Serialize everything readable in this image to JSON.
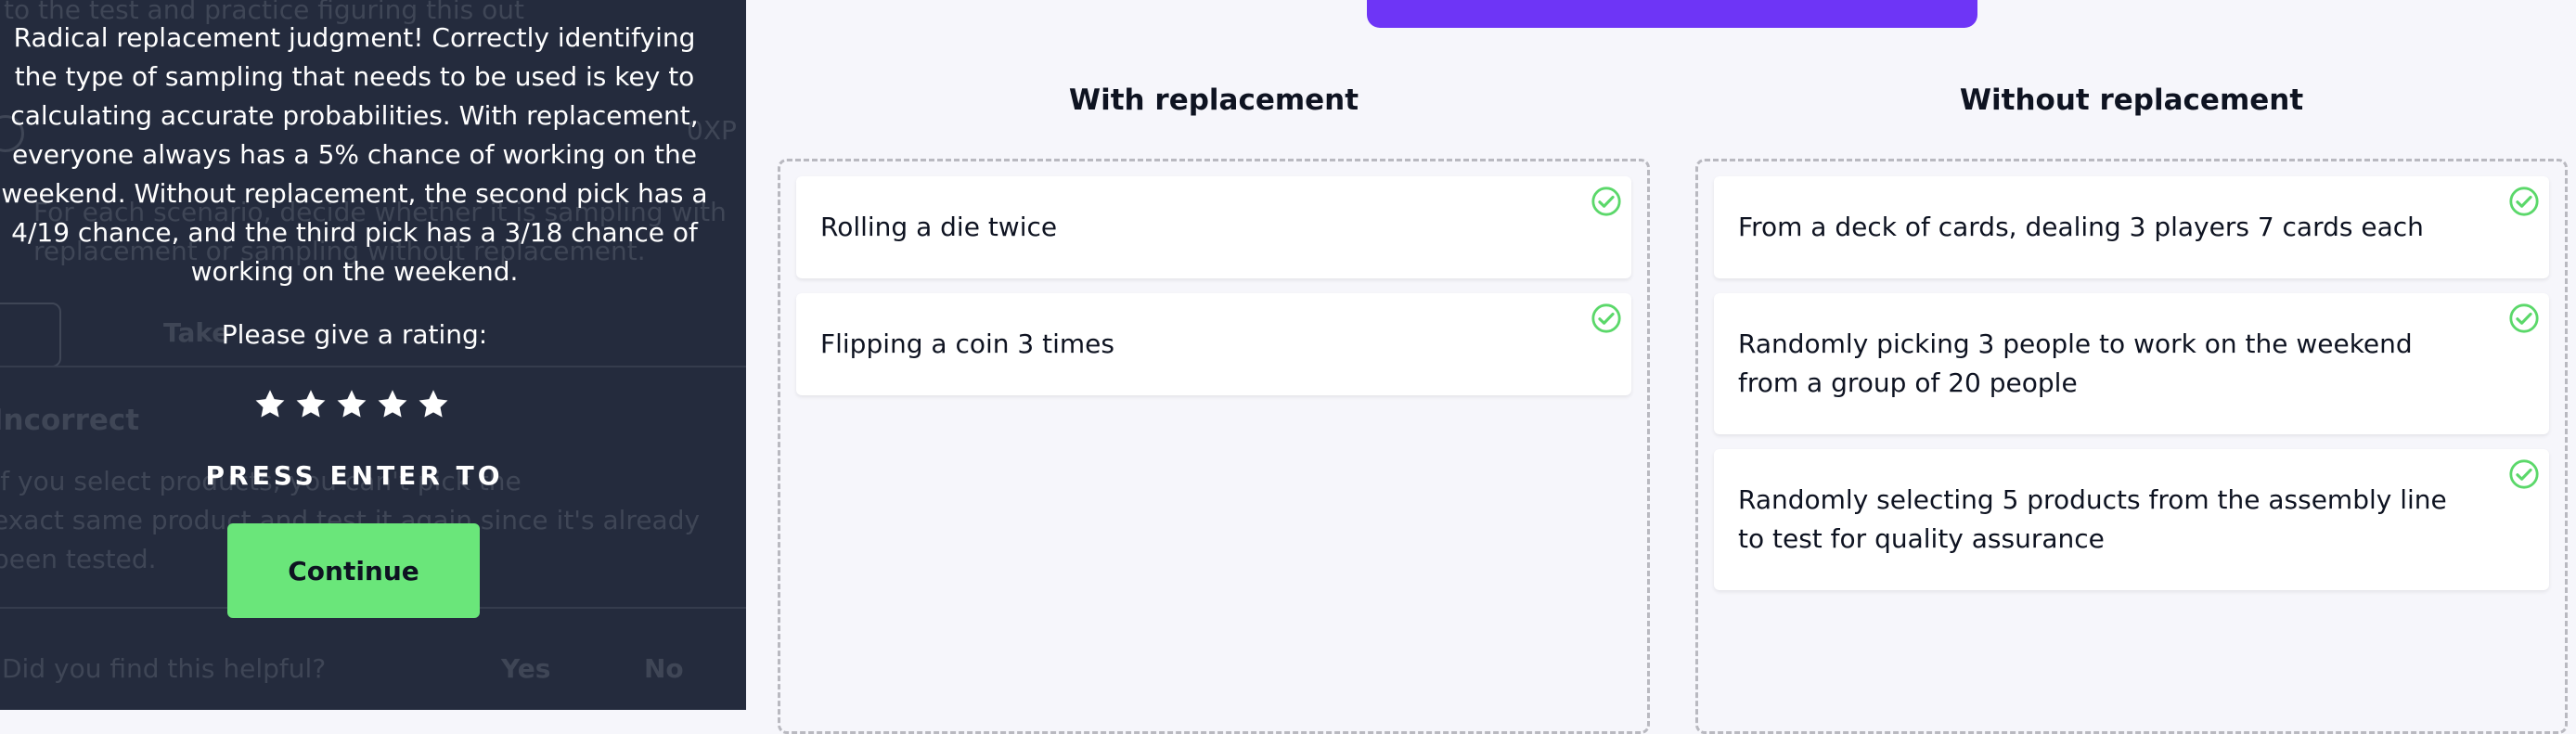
{
  "background_panel": {
    "lines": [
      "to the test and practice figuring this out",
      "0XP",
      "For each scenario, decide whether it is sampling with",
      "replacement or sampling without replacement.",
      "Take",
      "Incorrect",
      "If you select products, you can't pick the",
      "exact same product and test it again since it's already",
      "been tested.",
      "Did you find this helpful?",
      "Yes",
      "No"
    ]
  },
  "feedback": {
    "message": "Radical replacement judgment! Correctly identifying the type of sampling that needs to be used is key to calculating accurate probabilities. With replacement, everyone always has a 5% chance of working on the weekend. Without replacement, the second pick has a 4/19 chance, and the third pick has a 3/18 chance of working on the weekend.",
    "rating_prompt": "Please give a rating:",
    "star_count": 5,
    "press_enter": "PRESS ENTER TO",
    "continue_label": "Continue"
  },
  "columns": [
    {
      "heading": "With replacement",
      "cards": [
        {
          "text": "Rolling a die twice",
          "status_icon": "check-circle-icon"
        },
        {
          "text": "Flipping a coin 3 times",
          "status_icon": "check-circle-icon"
        }
      ]
    },
    {
      "heading": "Without replacement",
      "cards": [
        {
          "text": "From a deck of cards, dealing 3 players 7 cards each",
          "status_icon": "check-circle-icon"
        },
        {
          "text": "Randomly picking 3 people to work on the weekend from a group of 20 people",
          "status_icon": "check-circle-icon"
        },
        {
          "text": "Randomly selecting 5 products from the assembly line to test for quality assurance",
          "status_icon": "check-circle-icon"
        }
      ]
    }
  ],
  "colors": {
    "panel_bg": "#242b3d",
    "accent_purple": "#6e35f6",
    "continue_green": "#6ae67a",
    "check_green": "#5bd86a"
  }
}
